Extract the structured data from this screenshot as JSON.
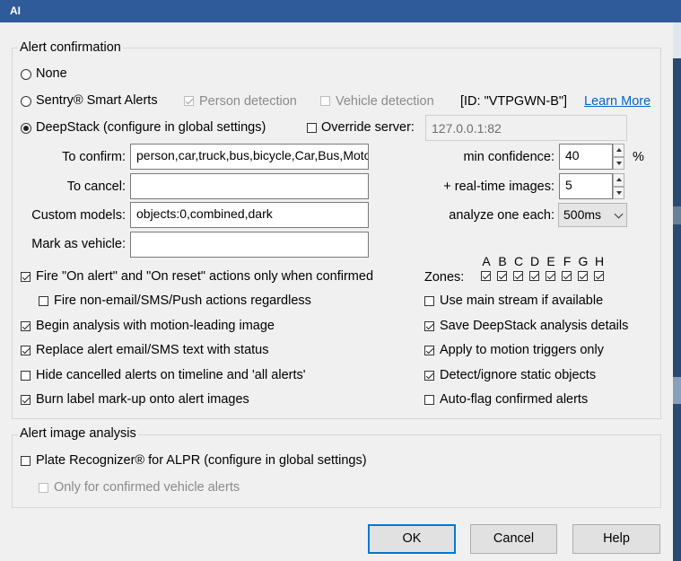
{
  "window": {
    "title": "AI"
  },
  "alert_confirmation": {
    "legend": "Alert confirmation",
    "mode_none": "None",
    "mode_sentry": "Sentry® Smart Alerts",
    "person_detection": "Person detection",
    "vehicle_detection": "Vehicle detection",
    "sentry_id": "[ID: \"VTPGWN-B\"]",
    "learn_more": "Learn More",
    "mode_deepstack": "DeepStack (configure in global settings)",
    "override_server": "Override server:",
    "override_server_value": "127.0.0.1:82",
    "to_confirm_label": "To confirm:",
    "to_confirm_value": "person,car,truck,bus,bicycle,Car,Bus,Motorcycle",
    "to_cancel_label": "To cancel:",
    "to_cancel_value": "",
    "custom_models_label": "Custom models:",
    "custom_models_value": "objects:0,combined,dark",
    "mark_as_vehicle_label": "Mark as vehicle:",
    "mark_as_vehicle_value": "",
    "min_confidence_label": "min confidence:",
    "min_confidence_value": "40",
    "percent_unit": "%",
    "realtime_images_label": "+ real-time images:",
    "realtime_images_value": "5",
    "analyze_each_label": "analyze one each:",
    "analyze_each_value": "500ms",
    "zones_label": "Zones:",
    "zones": [
      "A",
      "B",
      "C",
      "D",
      "E",
      "F",
      "G",
      "H"
    ],
    "opt_fire_on_alert": "Fire \"On alert\" and \"On reset\" actions only when confirmed",
    "opt_fire_non_email": "Fire non-email/SMS/Push actions regardless",
    "opt_begin_analysis": "Begin analysis with motion-leading image",
    "opt_replace_alert": "Replace alert email/SMS text with status",
    "opt_hide_cancelled": "Hide cancelled alerts on timeline and  'all alerts'",
    "opt_burn_label": "Burn label mark-up onto alert images",
    "opt_use_main_stream": "Use main stream if available",
    "opt_save_deepstack": "Save DeepStack analysis details",
    "opt_apply_motion": "Apply to motion triggers only",
    "opt_detect_static": "Detect/ignore static objects",
    "opt_auto_flag": "Auto-flag confirmed alerts"
  },
  "alert_image_analysis": {
    "legend": "Alert image analysis",
    "plate_recognizer": "Plate Recognizer® for ALPR (configure in global settings)",
    "only_confirmed_vehicle": "Only for confirmed vehicle alerts"
  },
  "buttons": {
    "ok": "OK",
    "cancel": "Cancel",
    "help": "Help"
  }
}
